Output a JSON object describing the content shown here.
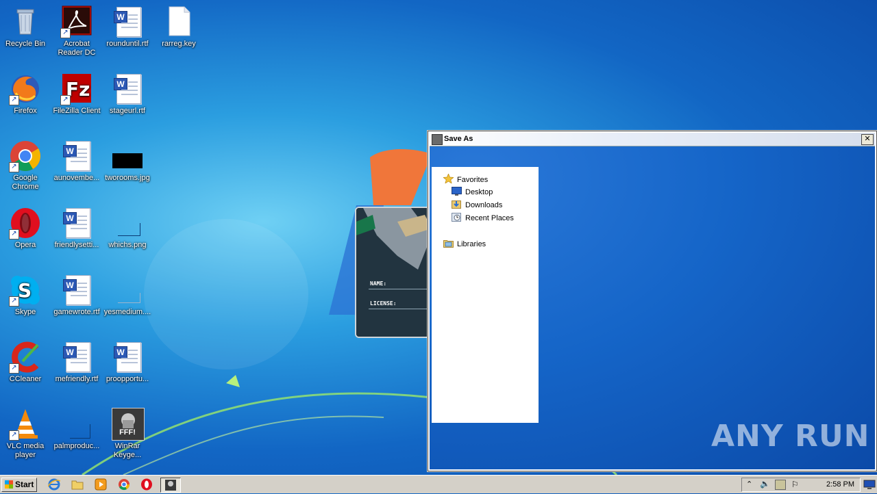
{
  "desktop": {
    "icons": [
      {
        "label": "Recycle Bin",
        "icon": "recycle-bin-icon"
      },
      {
        "label": "Acrobat Reader DC",
        "icon": "acrobat-icon"
      },
      {
        "label": "rounduntil.rtf",
        "icon": "word-doc-icon"
      },
      {
        "label": "rarreg.key",
        "icon": "blank-file-icon"
      },
      {
        "label": "Firefox",
        "icon": "firefox-icon"
      },
      {
        "label": "FileZilla Client",
        "icon": "filezilla-icon"
      },
      {
        "label": "stageurl.rtf",
        "icon": "word-doc-icon"
      },
      {
        "label": "Google Chrome",
        "icon": "chrome-icon"
      },
      {
        "label": "aunovembe...",
        "icon": "word-doc-icon"
      },
      {
        "label": "tworooms.jpg",
        "icon": "image-file-icon"
      },
      {
        "label": "Opera",
        "icon": "opera-icon"
      },
      {
        "label": "friendlysetti...",
        "icon": "word-doc-icon"
      },
      {
        "label": "whichs.png",
        "icon": "image-file-icon"
      },
      {
        "label": "Skype",
        "icon": "skype-icon"
      },
      {
        "label": "gamewrote.rtf",
        "icon": "word-doc-icon"
      },
      {
        "label": "yesmedium....",
        "icon": "image-file-icon"
      },
      {
        "label": "CCleaner",
        "icon": "ccleaner-icon"
      },
      {
        "label": "mefriendly.rtf",
        "icon": "word-doc-icon"
      },
      {
        "label": "proopportu...",
        "icon": "word-doc-icon"
      },
      {
        "label": "VLC media player",
        "icon": "vlc-icon"
      },
      {
        "label": "palmproduc...",
        "icon": "image-file-icon"
      },
      {
        "label": "WinRar Keyge...",
        "icon": "keygen-icon"
      }
    ]
  },
  "crack_window": {
    "name_label": "NAME:",
    "license_label": "LICENSE:"
  },
  "save_dialog": {
    "title": "Save As",
    "close_glyph": "✕",
    "nav": {
      "favorites": "Favorites",
      "desktop": "Desktop",
      "downloads": "Downloads",
      "recent": "Recent Places",
      "libraries": "Libraries"
    }
  },
  "taskbar": {
    "start_label": "Start",
    "clock": "2:58 PM",
    "keygen_badge": "FFF!"
  },
  "watermark": "ANY RUN"
}
